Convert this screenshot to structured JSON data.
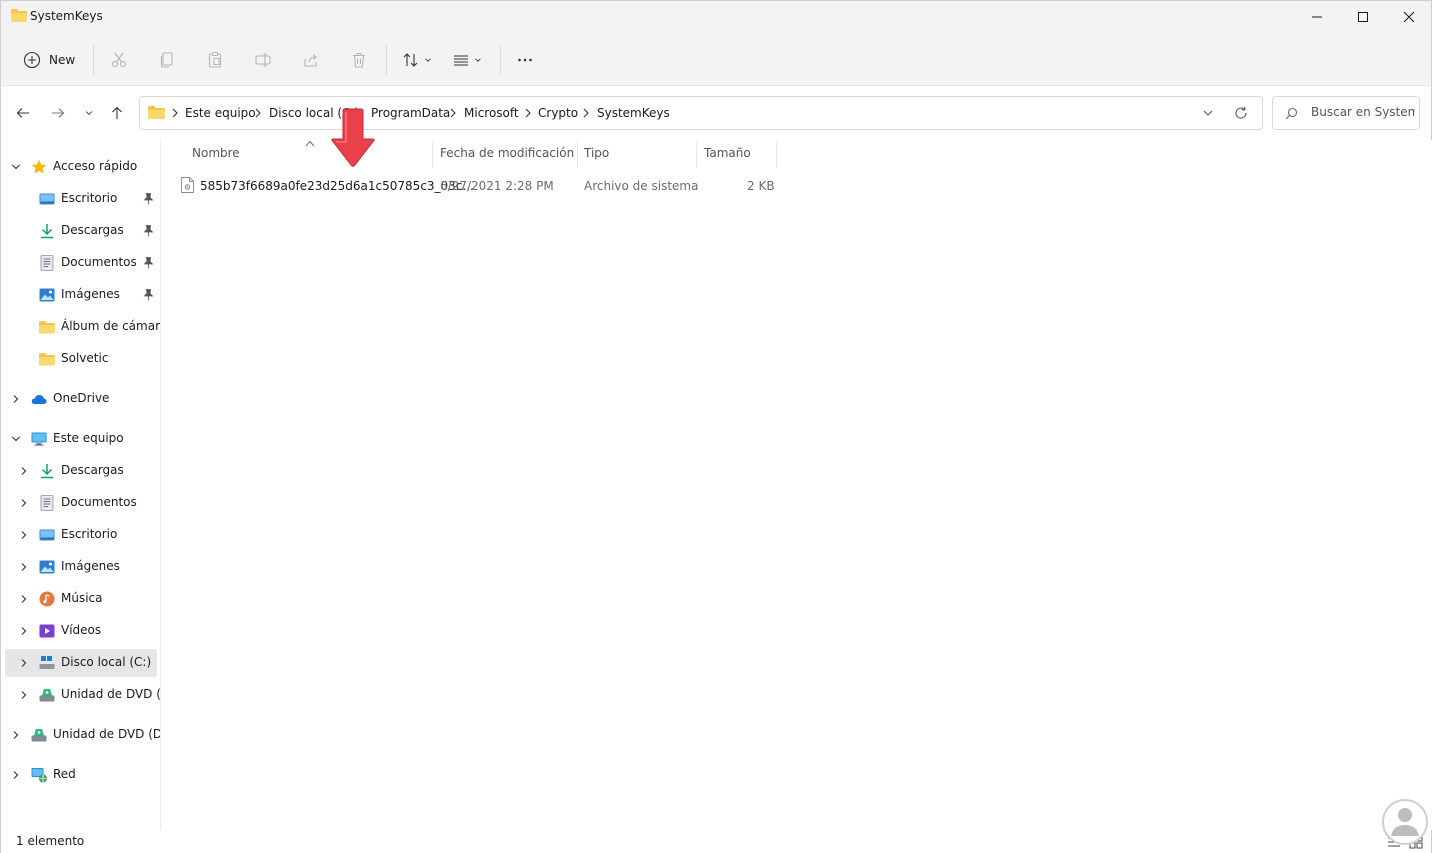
{
  "window": {
    "title": "SystemKeys"
  },
  "commands": {
    "new_label": "New"
  },
  "address": {
    "crumbs": [
      "Este equipo",
      "Disco local (C:)",
      "ProgramData",
      "Microsoft",
      "Crypto",
      "SystemKeys"
    ]
  },
  "search": {
    "placeholder": "Buscar en System..."
  },
  "sidebar": {
    "quick_access": {
      "label": "Acceso rápido",
      "items": [
        {
          "label": "Escritorio",
          "icon": "desktop-icon",
          "pinned": true
        },
        {
          "label": "Descargas",
          "icon": "download-icon",
          "pinned": true
        },
        {
          "label": "Documentos",
          "icon": "documents-icon",
          "pinned": true
        },
        {
          "label": "Imágenes",
          "icon": "pictures-icon",
          "pinned": true
        },
        {
          "label": "Álbum de cámara",
          "icon": "folder-icon",
          "pinned": false
        },
        {
          "label": "Solvetic",
          "icon": "folder-icon",
          "pinned": false
        }
      ]
    },
    "onedrive": {
      "label": "OneDrive"
    },
    "this_pc": {
      "label": "Este equipo",
      "items": [
        {
          "label": "Descargas",
          "icon": "download-icon"
        },
        {
          "label": "Documentos",
          "icon": "documents-icon"
        },
        {
          "label": "Escritorio",
          "icon": "desktop-icon"
        },
        {
          "label": "Imágenes",
          "icon": "pictures-icon"
        },
        {
          "label": "Música",
          "icon": "music-icon"
        },
        {
          "label": "Vídeos",
          "icon": "videos-icon"
        },
        {
          "label": "Disco local (C:)",
          "icon": "drive-icon"
        },
        {
          "label": "Unidad de DVD (D:",
          "icon": "dvd-icon"
        }
      ]
    },
    "dvd": {
      "label": "Unidad de DVD (D:)"
    },
    "network": {
      "label": "Red"
    }
  },
  "columns": {
    "name": "Nombre",
    "modified": "Fecha de modificación",
    "type": "Tipo",
    "size": "Tamaño"
  },
  "files": [
    {
      "name": "585b73f6689a0fe23d25d6a1c50785c3_03c...",
      "modified": "6/27/2021 2:28 PM",
      "type": "Archivo de sistema",
      "size": "2 KB"
    }
  ],
  "status": {
    "count": "1 elemento"
  },
  "colors": {
    "selected_bg": "#e6e6e6",
    "folder": "#f8c44f",
    "accent": "#0067c0",
    "arrow": "#e8414a"
  }
}
